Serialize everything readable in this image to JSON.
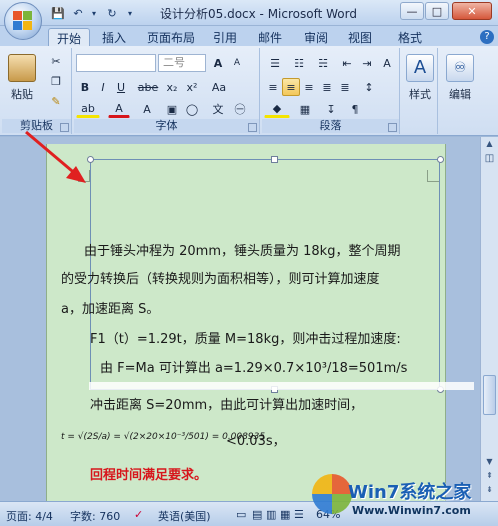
{
  "window": {
    "title": "设计分析05.docx - Microsoft Word",
    "minimize": "—",
    "restore": "□",
    "close": "✕"
  },
  "quick_access": {
    "save": "💾",
    "undo": "↶",
    "redo": "↻",
    "customize": "▾"
  },
  "tabs": [
    "开始",
    "插入",
    "页面布局",
    "引用",
    "邮件",
    "审阅",
    "视图",
    "格式"
  ],
  "ribbon": {
    "clipboard": {
      "label": "剪贴板",
      "paste_label": "粘贴"
    },
    "font": {
      "label": "字体",
      "font_name": "",
      "font_size": "二号",
      "bold": "B",
      "italic": "I",
      "underline": "U",
      "strike": "abe",
      "sub": "x₂",
      "sup": "x²",
      "grow": "A",
      "shrink": "A",
      "clear": "Aa",
      "highlight": "ab",
      "fontcolor": "A",
      "charscale": "A"
    },
    "paragraph": {
      "label": "段落"
    },
    "styles": {
      "label": "样式"
    },
    "editing": {
      "label": "编辑"
    }
  },
  "document": {
    "lines": [
      "由于锤头冲程为 20mm，锤头质量为 18kg，整个周期",
      "的受力转换后（转换规则为面积相等），则可计算加速度",
      "a，加速距离 S。",
      "F1（t）=1.29t，质量 M=18kg，则冲击过程加速度:",
      "由 F=Ma   可计算出 a=1.29×0.7×10³/18=501m/s",
      "冲击距离 S=20mm，由此可计算出加速时间，",
      "<0.03s，",
      "回程时间满足要求。"
    ],
    "formula": "t = √(2S/a) = √(2×20×10⁻³/501) = 0.008935"
  },
  "status_bar": {
    "page": "页面: 4/4",
    "words": "字数: 760",
    "language": "英语(美国)",
    "zoom": "64%"
  },
  "watermark": {
    "brand": "Win7系统之家",
    "url": "Www.Winwin7.com"
  },
  "colors": {
    "page_bg": "#cde8c9",
    "ribbon_bg": "#dbe6f4",
    "red_text": "#d7161c",
    "arrow": "#e02020"
  }
}
